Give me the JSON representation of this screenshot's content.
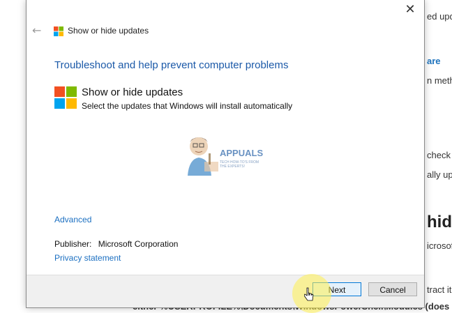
{
  "background": {
    "lines": [
      "ed upd",
      "are",
      "n meth",
      "check",
      "ally upo",
      "hid",
      "icrosof",
      "tract it",
      "either %USERPROFILE%\\Documents\\WindowsPowerShell\\Modules (does no"
    ]
  },
  "dialog": {
    "close_glyph": "✕",
    "title": "Show or hide updates",
    "heading": "Troubleshoot and help prevent computer problems",
    "tool": {
      "name": "Show or hide updates",
      "description": "Select the updates that Windows will install automatically"
    },
    "watermark": {
      "brand": "APPUALS",
      "tagline": "TECH HOW-TO'S FROM THE EXPERTS!"
    },
    "advanced_link": "Advanced",
    "publisher_label": "Publisher:",
    "publisher_value": "Microsoft Corporation",
    "privacy_link": "Privacy statement",
    "buttons": {
      "next": "Next",
      "cancel": "Cancel"
    }
  },
  "colors": {
    "heading": "#1b59a8",
    "link": "#1b6fc1",
    "logo_red": "#f25022",
    "logo_green": "#7fba00",
    "logo_blue": "#00a4ef",
    "logo_yellow": "#ffb900"
  }
}
